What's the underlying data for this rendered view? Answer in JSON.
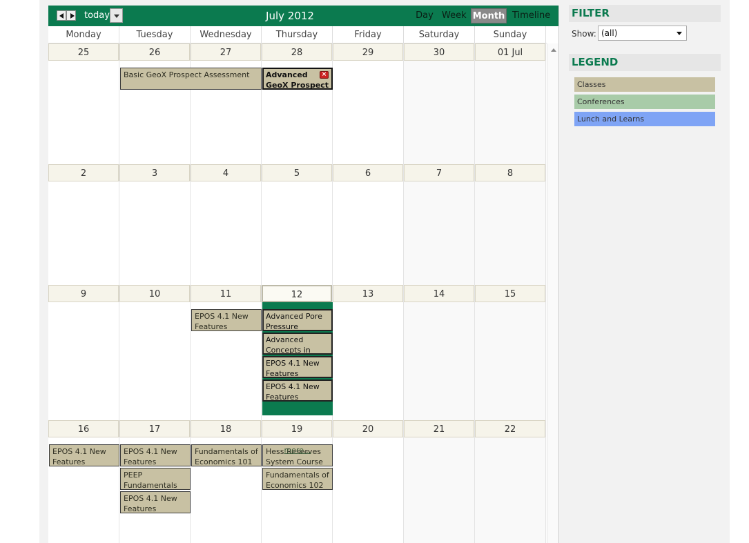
{
  "toolbar": {
    "today_label": "today",
    "title": "July 2012",
    "views": {
      "day": "Day",
      "week": "Week",
      "month": "Month",
      "timeline": "Timeline"
    },
    "active_view": "Month",
    "color": "#0b7a4f"
  },
  "day_names": [
    "Monday",
    "Tuesday",
    "Wednesday",
    "Thursday",
    "Friday",
    "Saturday",
    "Sunday"
  ],
  "weeks": [
    {
      "days": [
        "25",
        "26",
        "27",
        "28",
        "29",
        "30",
        "01 Jul"
      ]
    },
    {
      "days": [
        "2",
        "3",
        "4",
        "5",
        "6",
        "7",
        "8"
      ]
    },
    {
      "days": [
        "9",
        "10",
        "11",
        "12",
        "13",
        "14",
        "15"
      ]
    },
    {
      "days": [
        "16",
        "17",
        "18",
        "19",
        "20",
        "21",
        "22"
      ]
    }
  ],
  "today_cell": {
    "week": 2,
    "day": 3
  },
  "events": [
    {
      "week": 0,
      "day": 1,
      "span": 2,
      "slot": 0,
      "title": "Basic GeoX Prospect Assessment",
      "category": "Classes"
    },
    {
      "week": 0,
      "day": 3,
      "span": 1,
      "slot": 0,
      "title": "Advanced GeoX Prospect",
      "category": "Classes",
      "selected": true
    },
    {
      "week": 2,
      "day": 2,
      "span": 1,
      "slot": 0,
      "title": "EPOS 4.1 New Features",
      "category": "Classes"
    },
    {
      "week": 2,
      "day": 3,
      "span": 1,
      "slot": 0,
      "title": "Advanced Pore Pressure",
      "category": "Classes",
      "thick": true
    },
    {
      "week": 2,
      "day": 3,
      "span": 1,
      "slot": 1,
      "title": "Advanced Concepts in",
      "category": "Classes",
      "thick": true
    },
    {
      "week": 2,
      "day": 3,
      "span": 1,
      "slot": 2,
      "title": "EPOS 4.1 New Features",
      "category": "Classes",
      "thick": true
    },
    {
      "week": 2,
      "day": 3,
      "span": 1,
      "slot": 3,
      "title": "EPOS 4.1 New Features",
      "category": "Classes",
      "thick": true
    },
    {
      "week": 3,
      "day": 0,
      "span": 1,
      "slot": 0,
      "title": "EPOS 4.1 New Features",
      "category": "Classes"
    },
    {
      "week": 3,
      "day": 1,
      "span": 1,
      "slot": 0,
      "title": "EPOS 4.1 New Features",
      "category": "Classes"
    },
    {
      "week": 3,
      "day": 1,
      "span": 1,
      "slot": 1,
      "title": "PEEP Fundamentals",
      "category": "Classes"
    },
    {
      "week": 3,
      "day": 1,
      "span": 1,
      "slot": 2,
      "title": "EPOS 4.1 New Features",
      "category": "Classes"
    },
    {
      "week": 3,
      "day": 2,
      "span": 1,
      "slot": 0,
      "title": "Fundamentals of Economics 101",
      "category": "Classes"
    },
    {
      "week": 3,
      "day": 3,
      "span": 1,
      "slot": 0,
      "title": "Hess Reserves System Course",
      "category": "Classes"
    },
    {
      "week": 3,
      "day": 3,
      "span": 1,
      "slot": 1,
      "title": "Fundamentals of Economics 102",
      "category": "Classes"
    }
  ],
  "more_link": "more...",
  "filter": {
    "heading": "FILTER",
    "show_label": "Show:",
    "show_value": "(all)"
  },
  "legend": {
    "heading": "LEGEND",
    "items": [
      {
        "label": "Classes",
        "color": "#c8c1a3"
      },
      {
        "label": "Conferences",
        "color": "#a8cba8"
      },
      {
        "label": "Lunch and Learns",
        "color": "#7fa4f5"
      }
    ]
  }
}
